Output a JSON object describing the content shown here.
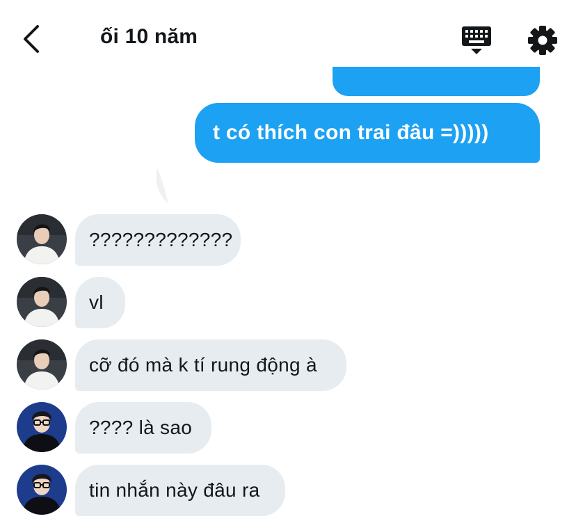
{
  "header": {
    "title": "ối 10 năm",
    "back_icon": "chevron-left-icon",
    "keyboard_icon": "keyboard-icon",
    "settings_icon": "gear-icon"
  },
  "sent_messages": [
    {
      "text": ""
    },
    {
      "text": "t có thích con trai đâu =)))))"
    }
  ],
  "received_messages": [
    {
      "text": "?????????????",
      "avatar": "avatar-boy-white-shirt"
    },
    {
      "text": "vl",
      "avatar": "avatar-boy-white-shirt"
    },
    {
      "text": "cỡ đó mà k tí rung động à",
      "avatar": "avatar-boy-white-shirt"
    },
    {
      "text": "???? là sao",
      "avatar": "avatar-boy-glasses"
    },
    {
      "text": "tin nhắn này đâu ra",
      "avatar": "avatar-boy-glasses"
    }
  ],
  "colors": {
    "accent": "#1da1f2",
    "incoming_bubble": "#e6ecf0",
    "text": "#14171a"
  }
}
